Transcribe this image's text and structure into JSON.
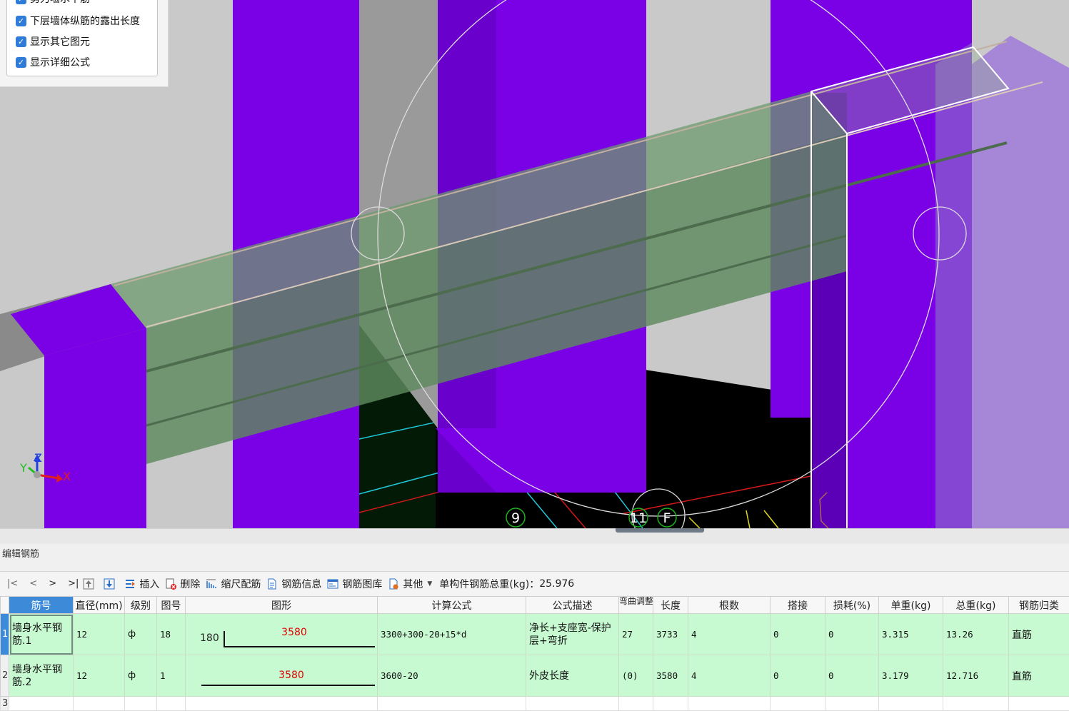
{
  "options": {
    "items": [
      {
        "label": "剪力墙水平筋",
        "checked": true
      },
      {
        "label": "下层墙体纵筋的露出长度",
        "checked": true
      },
      {
        "label": "显示其它图元",
        "checked": true
      },
      {
        "label": "显示详细公式",
        "checked": true
      }
    ]
  },
  "viewport": {
    "axis_labels": {
      "x": "X",
      "y": "Y",
      "z": "Z"
    },
    "grid_labels": [
      "9",
      "11",
      "F"
    ]
  },
  "panel": {
    "title": "编辑钢筋"
  },
  "toolbar": {
    "nav": [
      "|<",
      "<",
      ">",
      ">|"
    ],
    "insert": "插入",
    "delete": "删除",
    "scale_rebar": "缩尺配筋",
    "rebar_info": "钢筋信息",
    "rebar_library": "钢筋图库",
    "other": "其他",
    "total_weight_label": "单构件钢筋总重(kg)：",
    "total_weight_value": "25.976"
  },
  "table": {
    "headers": [
      "筋号",
      "直径(mm)",
      "级别",
      "图号",
      "图形",
      "计算公式",
      "公式描述",
      "弯曲调整",
      "长度",
      "根数",
      "搭接",
      "损耗(%)",
      "单重(kg)",
      "总重(kg)",
      "钢筋归类"
    ],
    "rows": [
      {
        "num": "1",
        "name": "墙身水平钢筋.1",
        "diameter": "12",
        "grade": "ф",
        "figure_no": "18",
        "shape_left": "180",
        "shape_len": "3580",
        "formula": "3300+300-20+15*d",
        "desc": "净长+支座宽-保护层+弯折",
        "bend": "27",
        "length": "3733",
        "count": "4",
        "lap": "0",
        "loss": "0",
        "unit_weight": "3.315",
        "total_weight": "13.26",
        "category": "直筋"
      },
      {
        "num": "2",
        "name": "墙身水平钢筋.2",
        "diameter": "12",
        "grade": "ф",
        "figure_no": "1",
        "shape_left": "",
        "shape_len": "3580",
        "formula": "3600-20",
        "desc": "外皮长度",
        "bend": "(0)",
        "length": "3580",
        "count": "4",
        "lap": "0",
        "loss": "0",
        "unit_weight": "3.179",
        "total_weight": "12.716",
        "category": "直筋"
      }
    ],
    "empty_row_num": "3"
  },
  "colors": {
    "wall_purple": "#7a00e6",
    "beam_green": "#5e8a5e",
    "row_green": "#c8fad2",
    "header_selected": "#3d8ad9",
    "shape_text_red": "#e00000"
  }
}
